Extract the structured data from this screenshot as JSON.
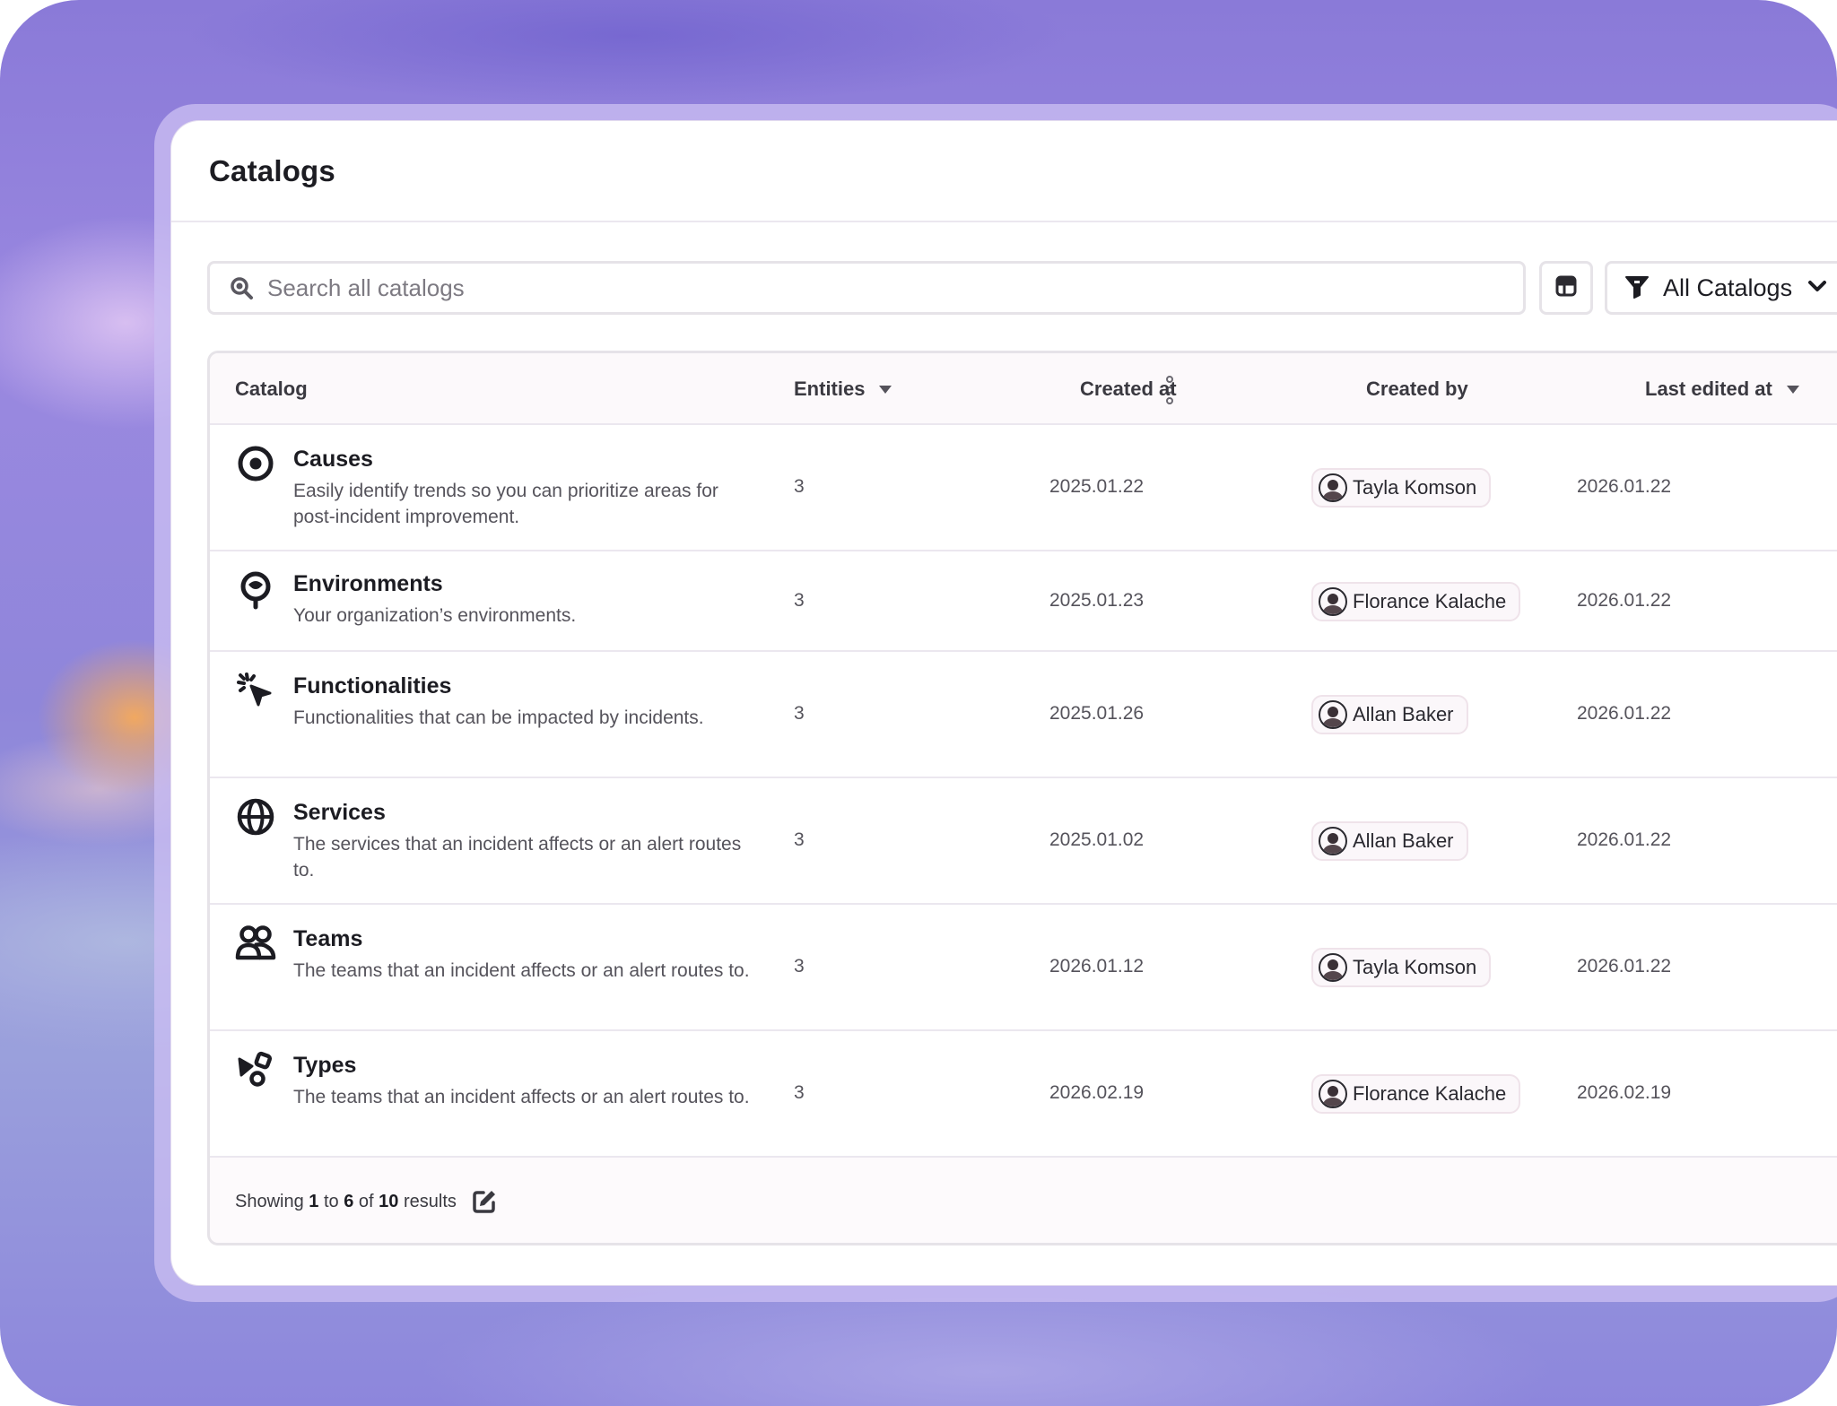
{
  "page": {
    "title": "Catalogs"
  },
  "toolbar": {
    "search_placeholder": "Search all catalogs",
    "layout_icon": "layout-grid-icon",
    "filter": {
      "icon": "filter-icon",
      "label": "All Catalogs",
      "chevron": "chevron-down-icon"
    }
  },
  "table": {
    "columns": {
      "catalog": "Catalog",
      "entities": "Entities",
      "created_at": "Created at",
      "created_by": "Created by",
      "last_edited_at": "Last edited at"
    },
    "rows": [
      {
        "icon": "target-icon",
        "name": "Causes",
        "description": "Easily identify trends so you can prioritize areas for post-incident improvement.",
        "entities": "3",
        "created_at": "2025.01.22",
        "created_by": "Tayla Komson",
        "last_edited_at": "2026.01.22"
      },
      {
        "icon": "environment-icon",
        "name": "Environments",
        "description": "Your organization’s environments.",
        "entities": "3",
        "created_at": "2025.01.23",
        "created_by": "Florance Kalache",
        "last_edited_at": "2026.01.22"
      },
      {
        "icon": "cursor-click-icon",
        "name": "Functionalities",
        "description": "Functionalities that can be impacted by incidents.",
        "entities": "3",
        "created_at": "2025.01.26",
        "created_by": "Allan Baker",
        "last_edited_at": "2026.01.22"
      },
      {
        "icon": "globe-icon",
        "name": "Services",
        "description": "The services that an incident affects or an alert routes to.",
        "entities": "3",
        "created_at": "2025.01.02",
        "created_by": "Allan Baker",
        "last_edited_at": "2026.01.22"
      },
      {
        "icon": "users-icon",
        "name": "Teams",
        "description": "The teams that an incident affects or an alert routes to.",
        "entities": "3",
        "created_at": "2026.01.12",
        "created_by": "Tayla Komson",
        "last_edited_at": "2026.01.22"
      },
      {
        "icon": "shapes-icon",
        "name": "Types",
        "description": "The teams that an incident affects or an alert routes to.",
        "entities": "3",
        "created_at": "2026.02.19",
        "created_by": "Florance Kalache",
        "last_edited_at": "2026.02.19"
      }
    ]
  },
  "footer": {
    "prefix": "Showing",
    "from": "1",
    "to_word": "to",
    "to": "6",
    "of_word": "of",
    "total": "10",
    "suffix": "results",
    "edit_icon": "edit-icon"
  },
  "colors": {
    "background_gradient_primary": "#8a7ad8",
    "panel": "#ffffff",
    "table_header": "#fcf9fb",
    "chip_bg": "#fbf7fa",
    "text_primary": "#1c1c22",
    "text_secondary": "#55535b"
  }
}
